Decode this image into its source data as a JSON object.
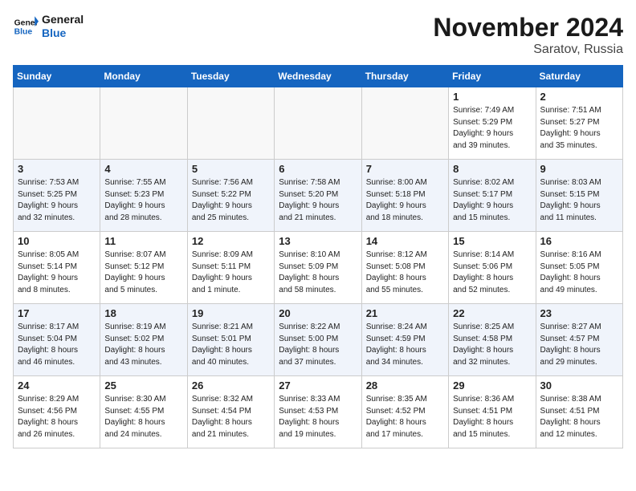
{
  "header": {
    "logo_general": "General",
    "logo_blue": "Blue",
    "month": "November 2024",
    "location": "Saratov, Russia"
  },
  "weekdays": [
    "Sunday",
    "Monday",
    "Tuesday",
    "Wednesday",
    "Thursday",
    "Friday",
    "Saturday"
  ],
  "weeks": [
    [
      {
        "day": "",
        "text": ""
      },
      {
        "day": "",
        "text": ""
      },
      {
        "day": "",
        "text": ""
      },
      {
        "day": "",
        "text": ""
      },
      {
        "day": "",
        "text": ""
      },
      {
        "day": "1",
        "text": "Sunrise: 7:49 AM\nSunset: 5:29 PM\nDaylight: 9 hours\nand 39 minutes."
      },
      {
        "day": "2",
        "text": "Sunrise: 7:51 AM\nSunset: 5:27 PM\nDaylight: 9 hours\nand 35 minutes."
      }
    ],
    [
      {
        "day": "3",
        "text": "Sunrise: 7:53 AM\nSunset: 5:25 PM\nDaylight: 9 hours\nand 32 minutes."
      },
      {
        "day": "4",
        "text": "Sunrise: 7:55 AM\nSunset: 5:23 PM\nDaylight: 9 hours\nand 28 minutes."
      },
      {
        "day": "5",
        "text": "Sunrise: 7:56 AM\nSunset: 5:22 PM\nDaylight: 9 hours\nand 25 minutes."
      },
      {
        "day": "6",
        "text": "Sunrise: 7:58 AM\nSunset: 5:20 PM\nDaylight: 9 hours\nand 21 minutes."
      },
      {
        "day": "7",
        "text": "Sunrise: 8:00 AM\nSunset: 5:18 PM\nDaylight: 9 hours\nand 18 minutes."
      },
      {
        "day": "8",
        "text": "Sunrise: 8:02 AM\nSunset: 5:17 PM\nDaylight: 9 hours\nand 15 minutes."
      },
      {
        "day": "9",
        "text": "Sunrise: 8:03 AM\nSunset: 5:15 PM\nDaylight: 9 hours\nand 11 minutes."
      }
    ],
    [
      {
        "day": "10",
        "text": "Sunrise: 8:05 AM\nSunset: 5:14 PM\nDaylight: 9 hours\nand 8 minutes."
      },
      {
        "day": "11",
        "text": "Sunrise: 8:07 AM\nSunset: 5:12 PM\nDaylight: 9 hours\nand 5 minutes."
      },
      {
        "day": "12",
        "text": "Sunrise: 8:09 AM\nSunset: 5:11 PM\nDaylight: 9 hours\nand 1 minute."
      },
      {
        "day": "13",
        "text": "Sunrise: 8:10 AM\nSunset: 5:09 PM\nDaylight: 8 hours\nand 58 minutes."
      },
      {
        "day": "14",
        "text": "Sunrise: 8:12 AM\nSunset: 5:08 PM\nDaylight: 8 hours\nand 55 minutes."
      },
      {
        "day": "15",
        "text": "Sunrise: 8:14 AM\nSunset: 5:06 PM\nDaylight: 8 hours\nand 52 minutes."
      },
      {
        "day": "16",
        "text": "Sunrise: 8:16 AM\nSunset: 5:05 PM\nDaylight: 8 hours\nand 49 minutes."
      }
    ],
    [
      {
        "day": "17",
        "text": "Sunrise: 8:17 AM\nSunset: 5:04 PM\nDaylight: 8 hours\nand 46 minutes."
      },
      {
        "day": "18",
        "text": "Sunrise: 8:19 AM\nSunset: 5:02 PM\nDaylight: 8 hours\nand 43 minutes."
      },
      {
        "day": "19",
        "text": "Sunrise: 8:21 AM\nSunset: 5:01 PM\nDaylight: 8 hours\nand 40 minutes."
      },
      {
        "day": "20",
        "text": "Sunrise: 8:22 AM\nSunset: 5:00 PM\nDaylight: 8 hours\nand 37 minutes."
      },
      {
        "day": "21",
        "text": "Sunrise: 8:24 AM\nSunset: 4:59 PM\nDaylight: 8 hours\nand 34 minutes."
      },
      {
        "day": "22",
        "text": "Sunrise: 8:25 AM\nSunset: 4:58 PM\nDaylight: 8 hours\nand 32 minutes."
      },
      {
        "day": "23",
        "text": "Sunrise: 8:27 AM\nSunset: 4:57 PM\nDaylight: 8 hours\nand 29 minutes."
      }
    ],
    [
      {
        "day": "24",
        "text": "Sunrise: 8:29 AM\nSunset: 4:56 PM\nDaylight: 8 hours\nand 26 minutes."
      },
      {
        "day": "25",
        "text": "Sunrise: 8:30 AM\nSunset: 4:55 PM\nDaylight: 8 hours\nand 24 minutes."
      },
      {
        "day": "26",
        "text": "Sunrise: 8:32 AM\nSunset: 4:54 PM\nDaylight: 8 hours\nand 21 minutes."
      },
      {
        "day": "27",
        "text": "Sunrise: 8:33 AM\nSunset: 4:53 PM\nDaylight: 8 hours\nand 19 minutes."
      },
      {
        "day": "28",
        "text": "Sunrise: 8:35 AM\nSunset: 4:52 PM\nDaylight: 8 hours\nand 17 minutes."
      },
      {
        "day": "29",
        "text": "Sunrise: 8:36 AM\nSunset: 4:51 PM\nDaylight: 8 hours\nand 15 minutes."
      },
      {
        "day": "30",
        "text": "Sunrise: 8:38 AM\nSunset: 4:51 PM\nDaylight: 8 hours\nand 12 minutes."
      }
    ]
  ]
}
